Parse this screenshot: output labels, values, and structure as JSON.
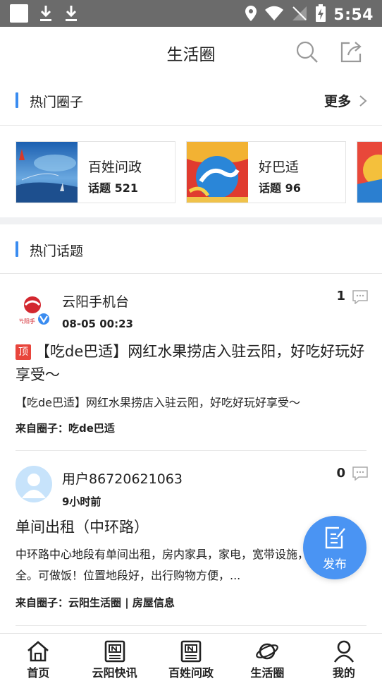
{
  "status_bar": {
    "time": "5:54"
  },
  "header": {
    "title": "生活圈"
  },
  "hot_circles": {
    "title": "热门圈子",
    "more": "更多",
    "items": [
      {
        "name": "百姓问政",
        "stat": "话题 521"
      },
      {
        "name": "好巴适",
        "stat": "话题 96"
      }
    ]
  },
  "hot_topics": {
    "title": "热门话题",
    "posts": [
      {
        "author": "云阳手机台",
        "time": "08-05 00:23",
        "comments": "1",
        "pinned_badge": "顶",
        "title": "【吃de巴适】网红水果捞店入驻云阳，好吃好玩好享受～",
        "excerpt": "【吃de巴适】网红水果捞店入驻云阳，好吃好玩好享受～",
        "from": "来自圈子：吃de巴适"
      },
      {
        "author": "用户86720621063",
        "time": "9小时前",
        "comments": "0",
        "title": "单间出租（中环路）",
        "excerpt": "中环路中心地段有单间出租，房内家具，家电，宽带设施，设备齐全。可做饭！位置地段好，出行购物方便，...",
        "from": "来自圈子：云阳生活圈 | 房屋信息"
      }
    ]
  },
  "fab": {
    "label": "发布"
  },
  "bottom_nav": [
    {
      "label": "首页",
      "icon": "home-icon"
    },
    {
      "label": "云阳快讯",
      "icon": "news-icon"
    },
    {
      "label": "百姓问政",
      "icon": "news-icon"
    },
    {
      "label": "生活圈",
      "icon": "planet-icon"
    },
    {
      "label": "我的",
      "icon": "user-icon"
    }
  ],
  "colors": {
    "accent": "#3a8cf0",
    "fab": "#4a94f3",
    "badge": "#e8453c"
  }
}
